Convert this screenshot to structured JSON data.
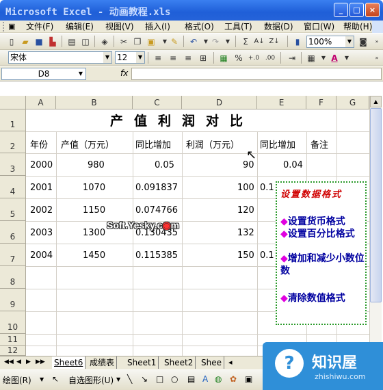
{
  "window": {
    "title": "Microsoft Excel - 动画教程.xls",
    "controls": [
      "_",
      "□",
      "×"
    ]
  },
  "menu": [
    "文件(F)",
    "编辑(E)",
    "视图(V)",
    "插入(I)",
    "格式(O)",
    "工具(T)",
    "数据(D)",
    "窗口(W)",
    "帮助(H)"
  ],
  "toolbar": {
    "zoom": "100%",
    "font_name": "宋体",
    "font_size": "12"
  },
  "formula_bar": {
    "name_box": "D8",
    "fx_label": "fx",
    "formula": ""
  },
  "columns": [
    "A",
    "B",
    "C",
    "D",
    "E",
    "F",
    "G"
  ],
  "rows": [
    "1",
    "2",
    "3",
    "4",
    "5",
    "6",
    "7",
    "8",
    "9",
    "10",
    "11",
    "12"
  ],
  "table": {
    "title": "产值利润对比",
    "headers": [
      "年份",
      "产值（万元）",
      "同比增加",
      "利润（万元）",
      "同比增加",
      "备注"
    ],
    "data": [
      [
        "2000",
        "980",
        "0.05",
        "90",
        "0.04"
      ],
      [
        "2001",
        "1070",
        "0.091837",
        "100",
        "0.1"
      ],
      [
        "2002",
        "1150",
        "0.074766",
        "120",
        ""
      ],
      [
        "2003",
        "1300",
        "0.130435",
        "132",
        ""
      ],
      [
        "2004",
        "1450",
        "0.115385",
        "150",
        "0.1"
      ]
    ]
  },
  "sheet_tabs": [
    "Sheet6",
    "成绩表",
    "Sheet1",
    "Sheet2",
    "Shee"
  ],
  "tab_nav": [
    "◀◀",
    "◀",
    "▶",
    "▶▶"
  ],
  "drawing_toolbar": {
    "draw_label": "绘图(R)",
    "autoshape_label": "自选图形(U)"
  },
  "popup": {
    "title": "设置数据格式",
    "items": [
      "设置货币格式",
      "设置百分比格式",
      "增加和减少小数位数",
      "清除数值格式"
    ],
    "bullet": "◆"
  },
  "watermark": "Soft.Yesky.c",
  "watermark_suffix": "m",
  "logo": {
    "name": "知识屋",
    "domain": "zhishiwu.com",
    "mark": "?"
  },
  "colors": {
    "title_bar": "#2563d9",
    "popup_title": "#d00000",
    "popup_text": "#0000a0",
    "popup_bullet": "#e000e0",
    "popup_border": "#2a9a2a",
    "logo_bg": "#2f8fd8"
  }
}
